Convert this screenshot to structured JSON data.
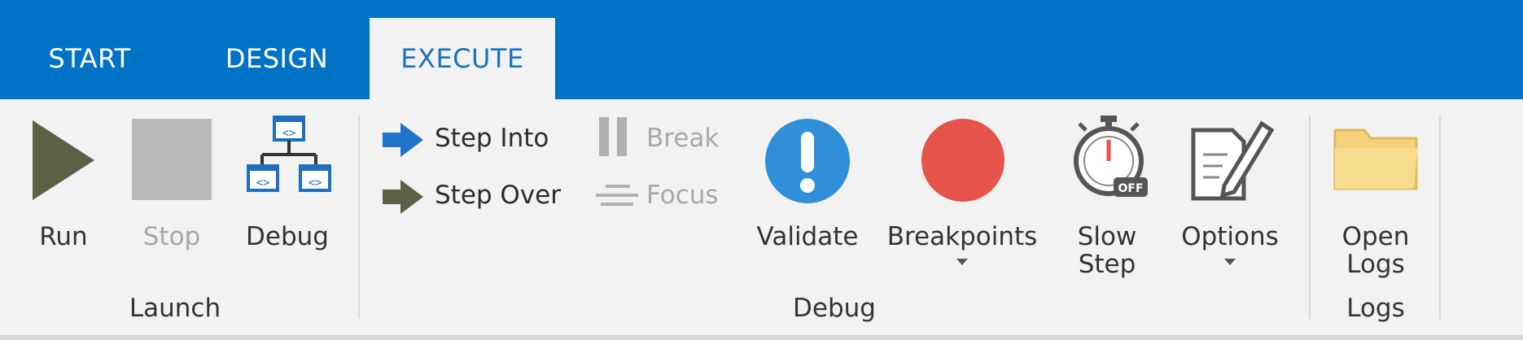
{
  "tabs": [
    {
      "label": "START",
      "active": false
    },
    {
      "label": "DESIGN",
      "active": false
    },
    {
      "label": "EXECUTE",
      "active": true
    }
  ],
  "launch": {
    "group_label": "Launch",
    "run_label": "Run",
    "stop_label": "Stop",
    "debug_label": "Debug"
  },
  "debug": {
    "group_label": "Debug",
    "step_into_label": "Step Into",
    "step_over_label": "Step Over",
    "break_label": "Break",
    "focus_label": "Focus",
    "validate_label": "Validate",
    "breakpoints_label": "Breakpoints",
    "slow_step_line1": "Slow",
    "slow_step_line2": "Step",
    "slow_step_badge": "OFF",
    "options_label": "Options"
  },
  "logs": {
    "group_label": "Logs",
    "open_logs_line1": "Open",
    "open_logs_line2": "Logs"
  },
  "colors": {
    "tab_bar": "#0073c6",
    "ribbon_bg": "#f2f2f2",
    "run_icon": "#5a6145",
    "validate_icon": "#2f8fd8",
    "breakpoints_icon": "#e5534b",
    "folder_icon": "#f5d27a"
  }
}
